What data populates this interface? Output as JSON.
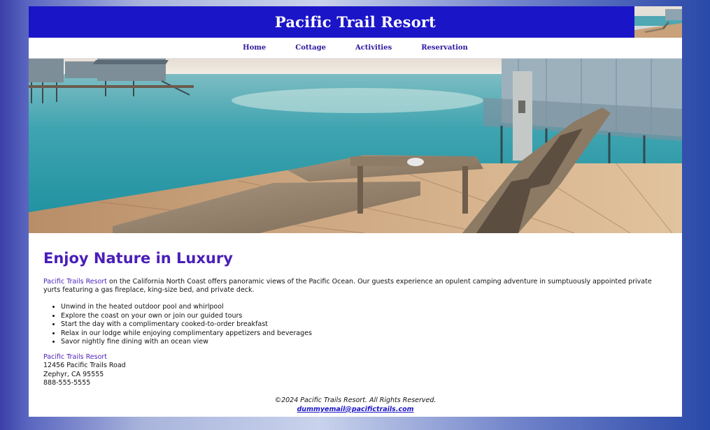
{
  "header": {
    "title": "Pacific Trail Resort"
  },
  "nav": {
    "items": [
      {
        "label": "Home"
      },
      {
        "label": "Cottage"
      },
      {
        "label": "Activities"
      },
      {
        "label": "Reservation"
      }
    ]
  },
  "main": {
    "heading": "Enjoy Nature in Luxury",
    "intro_name": "Pacific Trails Resort",
    "intro_text": " on the California North Coast offers panoramic views of the Pacific Ocean. Our guests experience an opulent camping adventure in sumptuously appointed private yurts featuring a gas fireplace, king-size bed, and private deck.",
    "features": [
      "Unwind in the heated outdoor pool and whirlpool",
      "Explore the coast on your own or join our guided tours",
      "Start the day with a complimentary cooked-to-order breakfast",
      "Relax in our lodge while enjoying complimentary appetizers and beverages",
      "Savor nightly fine dining with an ocean view"
    ],
    "address": {
      "name": "Pacific Trails Resort",
      "street": "12456 Pacific Trails Road",
      "city": "Zephyr, CA 95555",
      "phone": "888-555-5555"
    }
  },
  "footer": {
    "copyright": "©2024 Pacific Trails Resort. All Rights Reserved.",
    "email": "dummyemail@pacifictrails.com"
  },
  "colors": {
    "header_bg": "#1b15c8",
    "accent": "#4a1fb8",
    "nav_link": "#2a18a0"
  }
}
